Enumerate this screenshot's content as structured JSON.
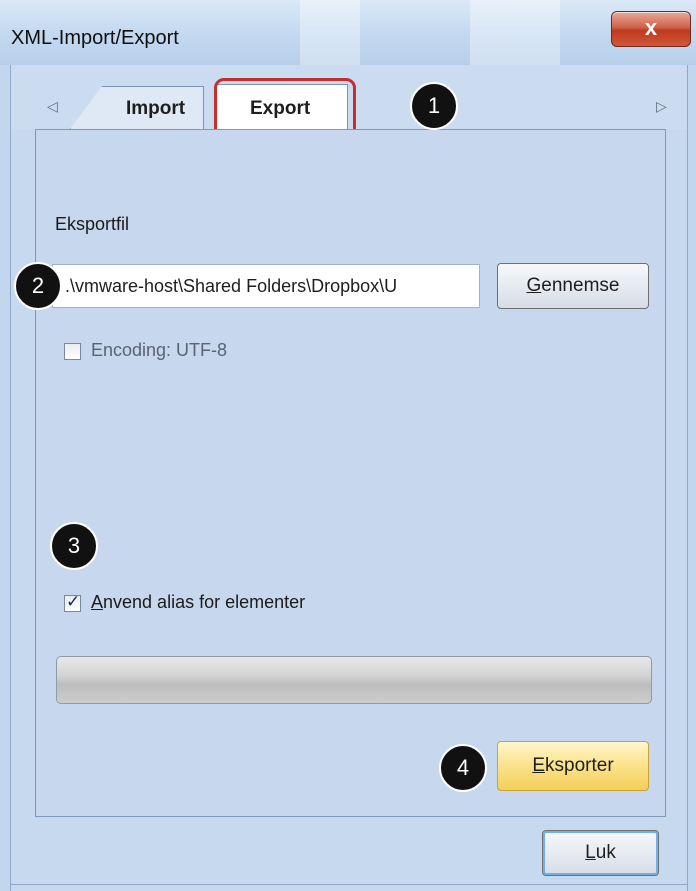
{
  "window": {
    "title": "XML-Import/Export",
    "close_glyph": "x",
    "accent_color": "#c62d2d"
  },
  "tabs": [
    {
      "label": "Import",
      "selected": false
    },
    {
      "label": "Export",
      "selected": true
    }
  ],
  "tab_scroll": {
    "left_icon": "◁",
    "right_icon": "▷"
  },
  "export_page": {
    "file_label": "Eksportfil",
    "file_path": ".\\vmware-host\\Shared Folders\\Dropbox\\U",
    "browse_button": {
      "label_first": "G",
      "label_rest": "ennemse"
    },
    "encoding_checkbox": {
      "label": "Encoding: UTF-8",
      "checked": false
    },
    "alias_checkbox": {
      "label_first": "A",
      "label_rest": "nvend alias for elementer",
      "checked": true
    },
    "progress": {
      "value": 0
    },
    "export_button": {
      "label_first": "E",
      "label_rest": "ksporter"
    }
  },
  "footer": {
    "close_button": {
      "label_first": "L",
      "label_rest": "uk"
    }
  },
  "annotations": [
    "1",
    "2",
    "3",
    "4"
  ]
}
